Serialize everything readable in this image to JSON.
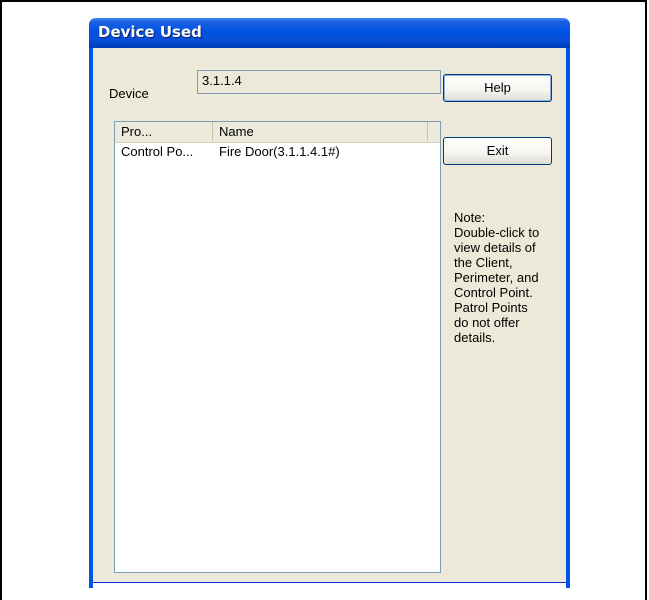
{
  "window": {
    "title": "Device Used"
  },
  "device": {
    "label": "Device",
    "value": "3.1.1.4"
  },
  "buttons": {
    "help_label": "Help",
    "exit_label": "Exit"
  },
  "list": {
    "columns": [
      "Pro...",
      "Name"
    ],
    "rows": [
      {
        "type": "Control Po...",
        "name": "Fire Door(3.1.1.4.1#)"
      }
    ]
  },
  "note": "Note:\nDouble-click to\nview details of\nthe Client,\nPerimeter, and\nControl Point.\nPatrol Points\ndo not offer\ndetails."
}
